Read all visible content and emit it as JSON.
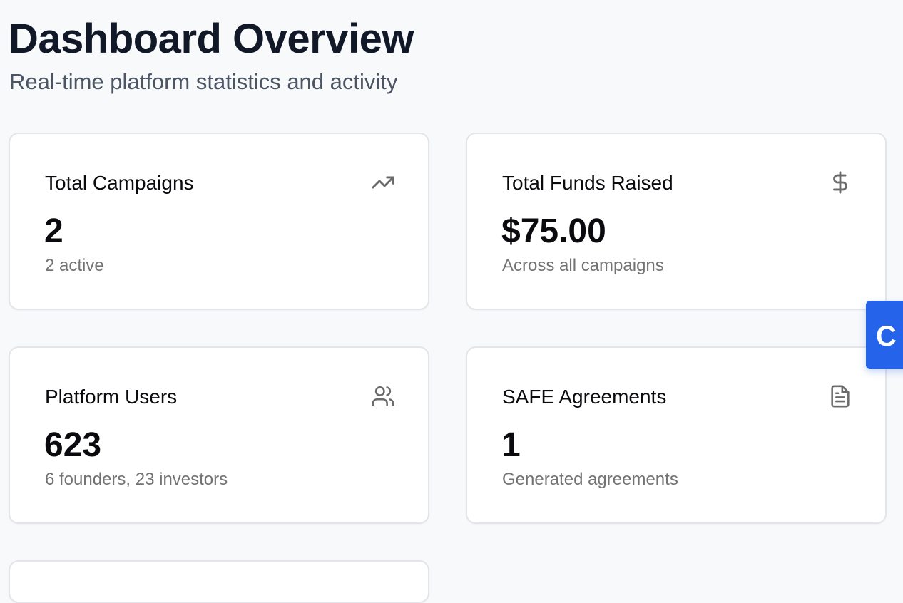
{
  "page": {
    "title": "Dashboard Overview",
    "subtitle": "Real-time platform statistics and activity"
  },
  "stats": [
    {
      "label": "Total Campaigns",
      "value": "2",
      "sub": "2 active",
      "icon": "trending-up-icon"
    },
    {
      "label": "Total Funds Raised",
      "value": "$75.00",
      "sub": "Across all campaigns",
      "icon": "dollar-icon"
    },
    {
      "label": "Platform Users",
      "value": "623",
      "sub": "6 founders, 23 investors",
      "icon": "users-icon"
    },
    {
      "label": "SAFE Agreements",
      "value": "1",
      "sub": "Generated agreements",
      "icon": "document-icon"
    }
  ],
  "help_tab": {
    "label": "C"
  },
  "colors": {
    "background": "#f8f9fb",
    "card_border": "#e3e5e8",
    "accent_blue": "#2563eb",
    "muted_text": "#737373"
  }
}
